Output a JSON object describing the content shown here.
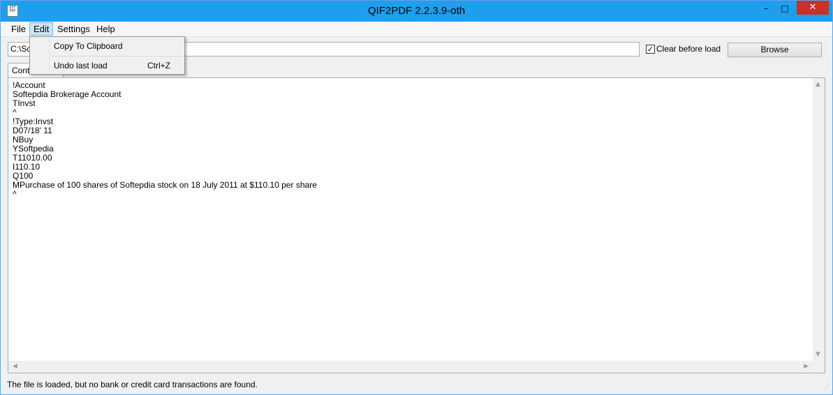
{
  "window": {
    "title": "QIF2PDF 2.2.3.9-oth",
    "icon_text": "QIF PDF",
    "controls": {
      "minimize": "–",
      "maximize": "□",
      "close": "✕"
    }
  },
  "menubar": {
    "items": [
      "File",
      "Edit",
      "Settings",
      "Help"
    ],
    "active": "Edit"
  },
  "edit_menu": {
    "items": [
      {
        "label": "Copy To Clipboard",
        "shortcut": ""
      },
      {
        "label": "Undo last load",
        "shortcut": "Ctrl+Z"
      }
    ]
  },
  "toolbar": {
    "path_value": "C:\\Sc",
    "clear_before_load_label": "Clear before load",
    "clear_before_load_checked": true,
    "browse_label": "Browse"
  },
  "tabs": [
    {
      "label": "Contents",
      "active": true
    }
  ],
  "content": {
    "lines": [
      "!Account",
      "Softepdia Brokerage Account",
      "TInvst",
      "^",
      "!Type:Invst",
      "D07/18' 11",
      "NBuy",
      "YSoftpedia",
      "T11010.00",
      "I110.10",
      "Q100",
      "MPurchase of 100 shares of Softepdia stock on 18 July 2011 at $110.10 per share",
      "^"
    ]
  },
  "status": {
    "text": "The file is loaded, but no bank or credit card transactions are found."
  },
  "icons": {
    "check": "✓",
    "arrow_up": "▲",
    "arrow_down": "▼",
    "arrow_left": "◀",
    "arrow_right": "▶",
    "grip": "⋰"
  },
  "colors": {
    "titlebar": "#1f9eee",
    "close_button": "#c7312b",
    "menu_highlight": "#cde4f7"
  }
}
